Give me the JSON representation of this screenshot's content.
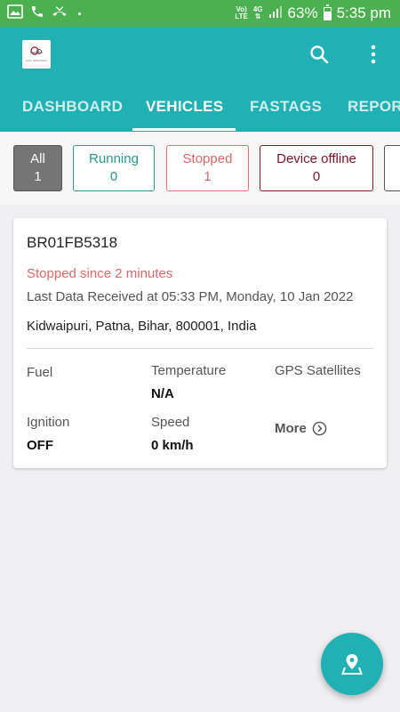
{
  "status_bar": {
    "volte_top": "Vo)",
    "volte_bottom": "LTE",
    "network_top": "4G",
    "battery": "63%",
    "time": "5:35 pm"
  },
  "app_bar": {
    "logo_text": "Auto Telematics",
    "icons": [
      "search-icon",
      "more-vert-icon"
    ]
  },
  "tabs": [
    {
      "label": "DASHBOARD",
      "active": false
    },
    {
      "label": "VEHICLES",
      "active": true
    },
    {
      "label": "FASTAGS",
      "active": false
    },
    {
      "label": "REPORTS",
      "active": false
    }
  ],
  "filters": [
    {
      "label": "All",
      "count": "1",
      "selected": true
    },
    {
      "label": "Running",
      "count": "0",
      "selected": false
    },
    {
      "label": "Stopped",
      "count": "1",
      "selected": false
    },
    {
      "label": "Device offline",
      "count": "0",
      "selected": false
    }
  ],
  "vehicle": {
    "number": "BR01FB5318",
    "status": "Stopped since 2 minutes",
    "last_data": "Last Data Received at 05:33 PM, Monday, 10 Jan 2022",
    "address": "Kidwaipuri, Patna, Bihar, 800001, India",
    "fuel_label": "Fuel",
    "fuel_value": "",
    "temperature_label": "Temperature",
    "temperature_value": "N/A",
    "gps_label": "GPS Satellites",
    "gps_value": "",
    "ignition_label": "Ignition",
    "ignition_value": "OFF",
    "speed_label": "Speed",
    "speed_value": "0 km/h",
    "more_label": "More"
  },
  "colors": {
    "status_bar": "#4caf50",
    "app_bar": "#21b0b3",
    "running": "#25998c",
    "stopped": "#e06666",
    "offline": "#7d1526"
  }
}
